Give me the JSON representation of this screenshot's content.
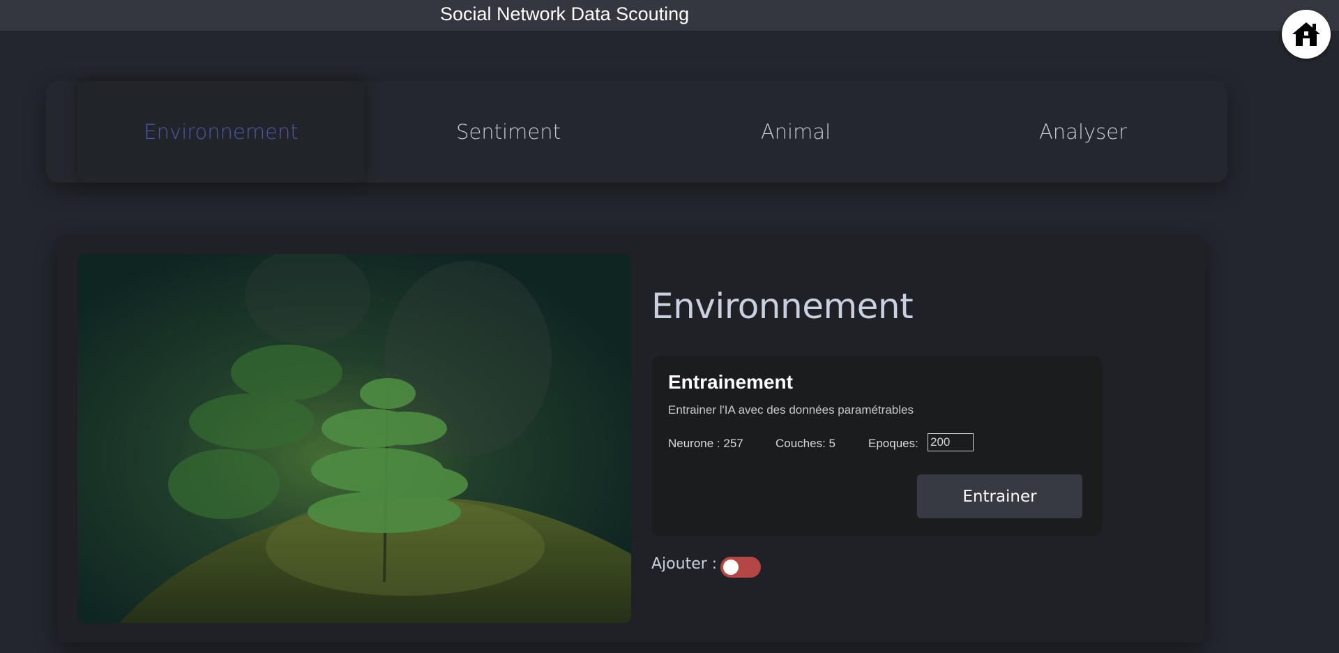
{
  "header": {
    "title": "Social Network Data Scouting",
    "home_icon": "home-icon"
  },
  "tabs": [
    {
      "label": "Environnement",
      "active": true
    },
    {
      "label": "Sentiment",
      "active": false
    },
    {
      "label": "Animal",
      "active": false
    },
    {
      "label": "Analyser",
      "active": false
    }
  ],
  "section": {
    "title": "Environnement",
    "image": "forest-seedling-on-moss-photo"
  },
  "training": {
    "title": "Entrainement",
    "description": "Entrainer l'IA avec des données paramétrables",
    "neurons_label": "Neurone : 257",
    "layers_label": "Couches: 5",
    "epochs_label": "Epoques:",
    "epochs_value": "200",
    "button_label": "Entrainer"
  },
  "add": {
    "label": "Ajouter :",
    "toggle_on": false
  },
  "colors": {
    "active_tab": "#5058a8",
    "toggle": "#b54646",
    "background": "#23262d"
  }
}
